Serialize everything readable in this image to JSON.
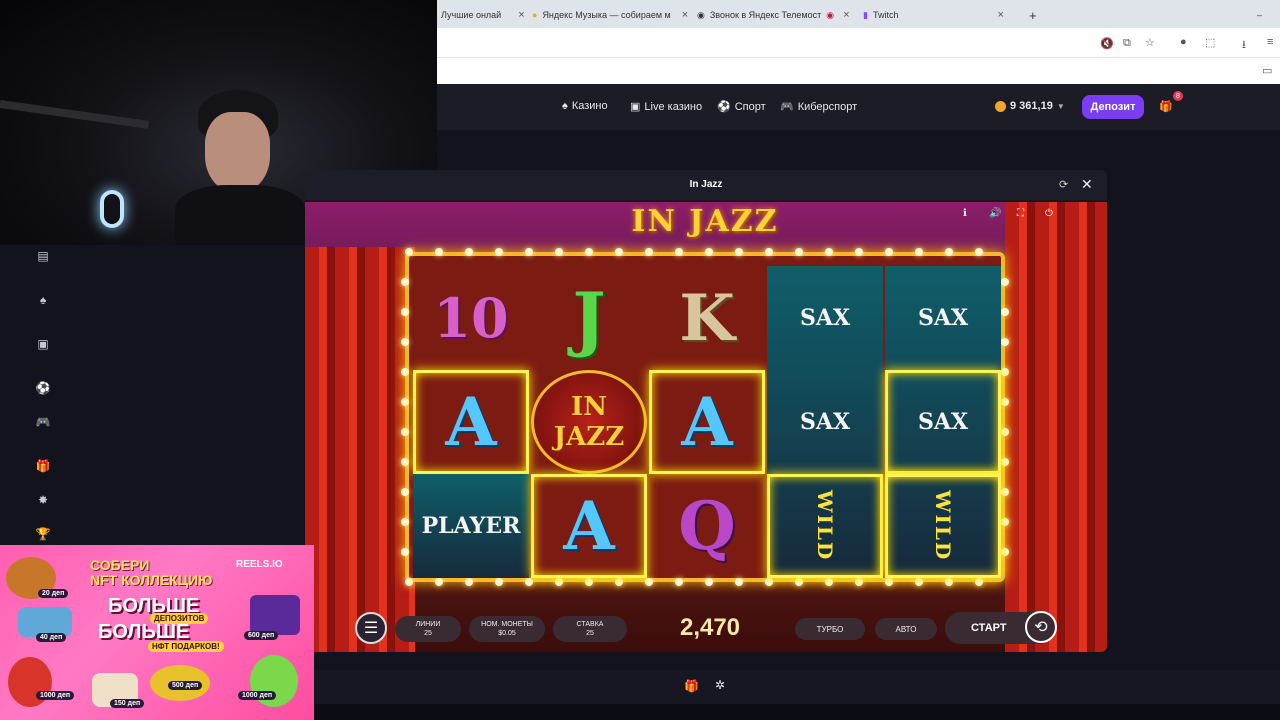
{
  "browser": {
    "tabs": [
      {
        "label": "Лучшие онлай",
        "close": "×"
      },
      {
        "label": "Яндекс Музыка — собираем м",
        "close": "×"
      },
      {
        "label": "Звонок в Яндекс Телемост",
        "close": "×"
      },
      {
        "label": "Twitch",
        "close": "×"
      }
    ],
    "new_tab": "+",
    "window_min": "–"
  },
  "site": {
    "nav": [
      {
        "icon": "casino-icon",
        "label": "Казино"
      },
      {
        "icon": "live-casino-icon",
        "label": "Live казино"
      },
      {
        "icon": "sport-icon",
        "label": "Спорт"
      },
      {
        "icon": "esport-icon",
        "label": "Киберспорт"
      }
    ],
    "balance": "9 361,19",
    "deposit_label": "Депозит",
    "gift_badge": "8"
  },
  "game": {
    "window_title": "In Jazz",
    "logo": "IN JAZZ",
    "reels": [
      [
        "10",
        "A",
        "PLAYER"
      ],
      [
        "J",
        "IN JAZZ",
        "A"
      ],
      [
        "K",
        "A",
        "Q"
      ],
      [
        "SAX",
        "SAX",
        "WILD"
      ],
      [
        "SAX",
        "SAX",
        "WILD"
      ]
    ],
    "win_cells": [
      [
        0,
        1
      ],
      [
        1,
        2
      ],
      [
        2,
        1
      ],
      [
        3,
        2
      ],
      [
        4,
        1
      ],
      [
        4,
        2
      ]
    ],
    "controls": {
      "lines_label": "ЛИНИИ",
      "lines_value": "25",
      "coin_label": "НОМ. МОНЕТЫ",
      "coin_value": "$0.05",
      "bet_label": "СТАВКА",
      "bet_value": "25",
      "win_amount": "2,470",
      "turbo_label": "ТУРБО",
      "auto_label": "АВТО",
      "start_label": "СТАРТ"
    }
  },
  "promo": {
    "line1": "СОБЕРИ",
    "line2": "NFT КОЛЛЕКЦИЮ",
    "brand": "REELS.IO",
    "line3": "БОЛЬШЕ",
    "tag1": "ДЕПОЗИТОВ",
    "line4": "БОЛЬШЕ",
    "tag2": "НФТ ПОДАРКОВ!",
    "deps": [
      "20 деп",
      "40 деп",
      "600 деп",
      "500 деп",
      "1000 деп",
      "150 деп",
      "1000 деп"
    ]
  },
  "colors": {
    "accent": "#7a3df2",
    "gold": "#f3b928",
    "badge": "#e23b5a"
  }
}
